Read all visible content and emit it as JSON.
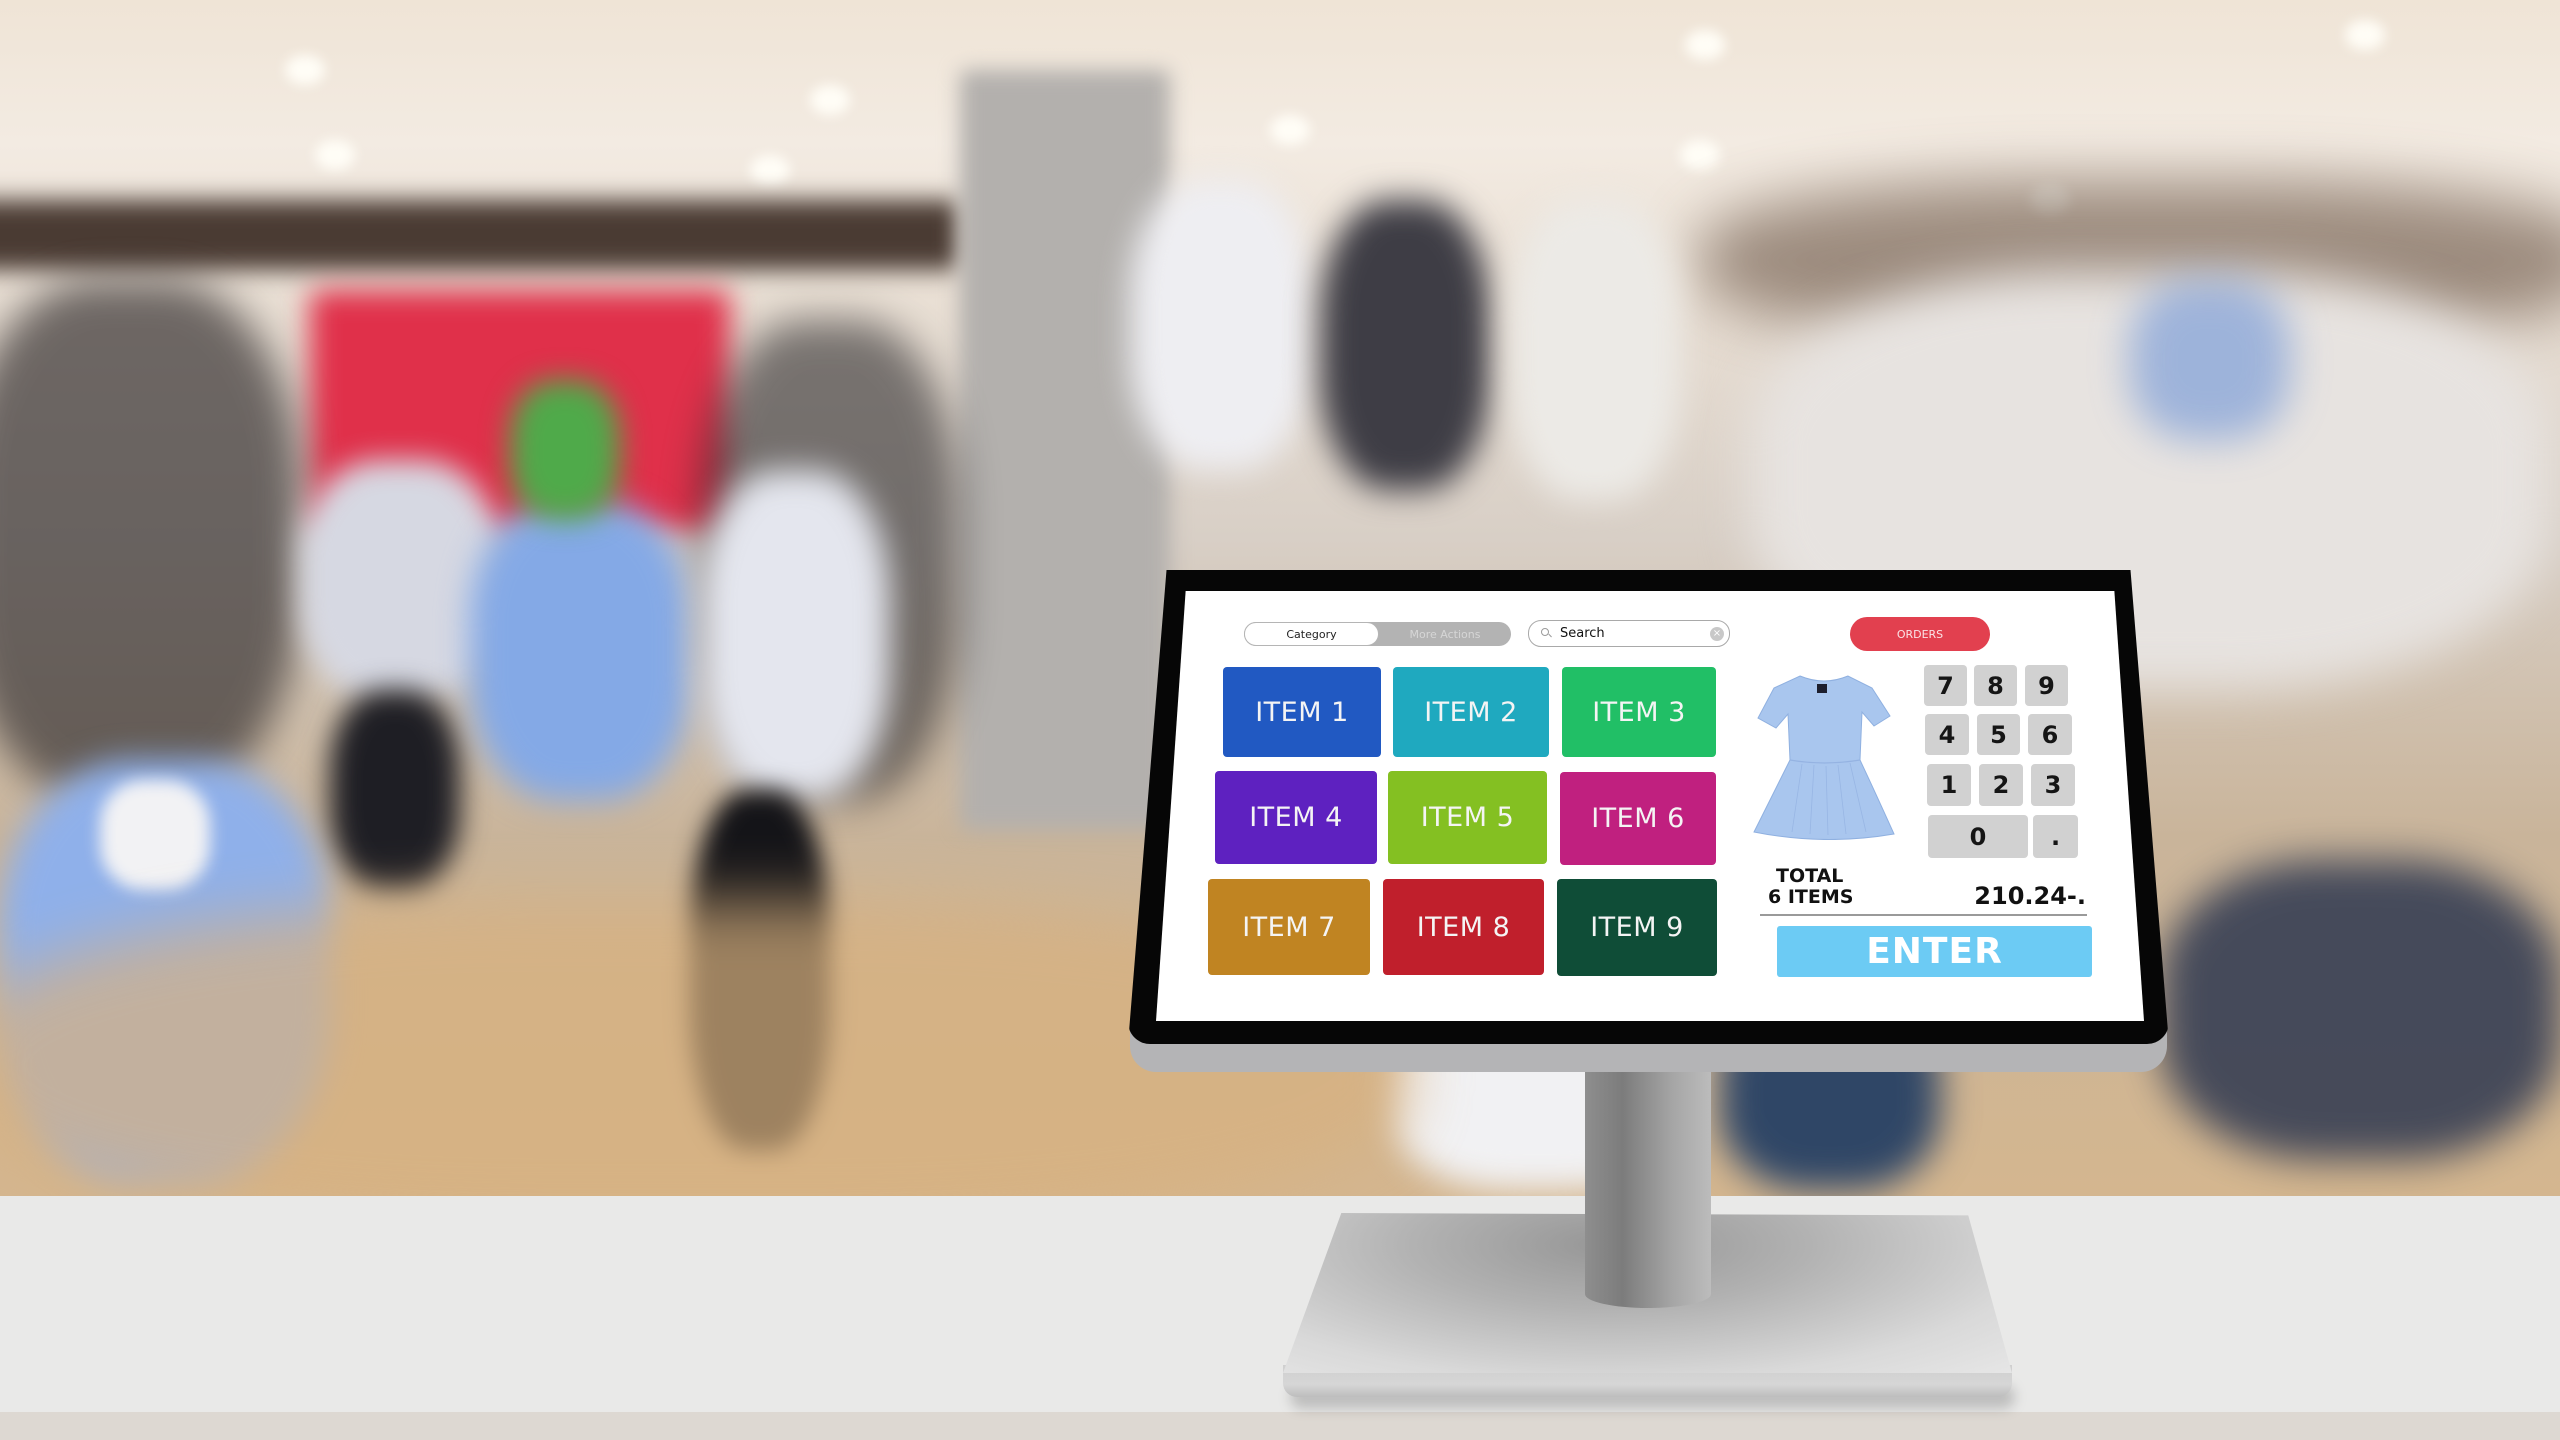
{
  "scene": {
    "description": "Blurred clothing store background with a POS touchscreen terminal on a white counter"
  },
  "pos": {
    "tabs": [
      {
        "label": "Category",
        "active": true
      },
      {
        "label": "More Actions",
        "active": false
      }
    ],
    "search": {
      "value": "Search",
      "search_icon": "magnifier-icon",
      "clear_icon": "clear-x-icon",
      "clear_glyph": "×"
    },
    "orders_button": {
      "label": "ORDERS",
      "color": "#e2404f"
    },
    "items": [
      {
        "label": "ITEM 1",
        "color": "#2159c2"
      },
      {
        "label": "ITEM 2",
        "color": "#1fa9bf"
      },
      {
        "label": "ITEM 3",
        "color": "#21bf66"
      },
      {
        "label": "ITEM 4",
        "color": "#5e21c0"
      },
      {
        "label": "ITEM 5",
        "color": "#84c022"
      },
      {
        "label": "ITEM 6",
        "color": "#c0207f"
      },
      {
        "label": "ITEM 7",
        "color": "#c08422"
      },
      {
        "label": "ITEM 8",
        "color": "#c01f2c"
      },
      {
        "label": "ITEM 9",
        "color": "#0f4d37"
      }
    ],
    "product_image": {
      "name": "light-blue-dress",
      "color": "#a9c6ee"
    },
    "keypad": [
      "7",
      "8",
      "9",
      "4",
      "5",
      "6",
      "1",
      "2",
      "3",
      "0",
      "."
    ],
    "total": {
      "label": "TOTAL",
      "count_label": "6 ITEMS",
      "amount": "210.24-."
    },
    "enter_button": {
      "label": "ENTER",
      "color": "#6ccbf4"
    }
  }
}
